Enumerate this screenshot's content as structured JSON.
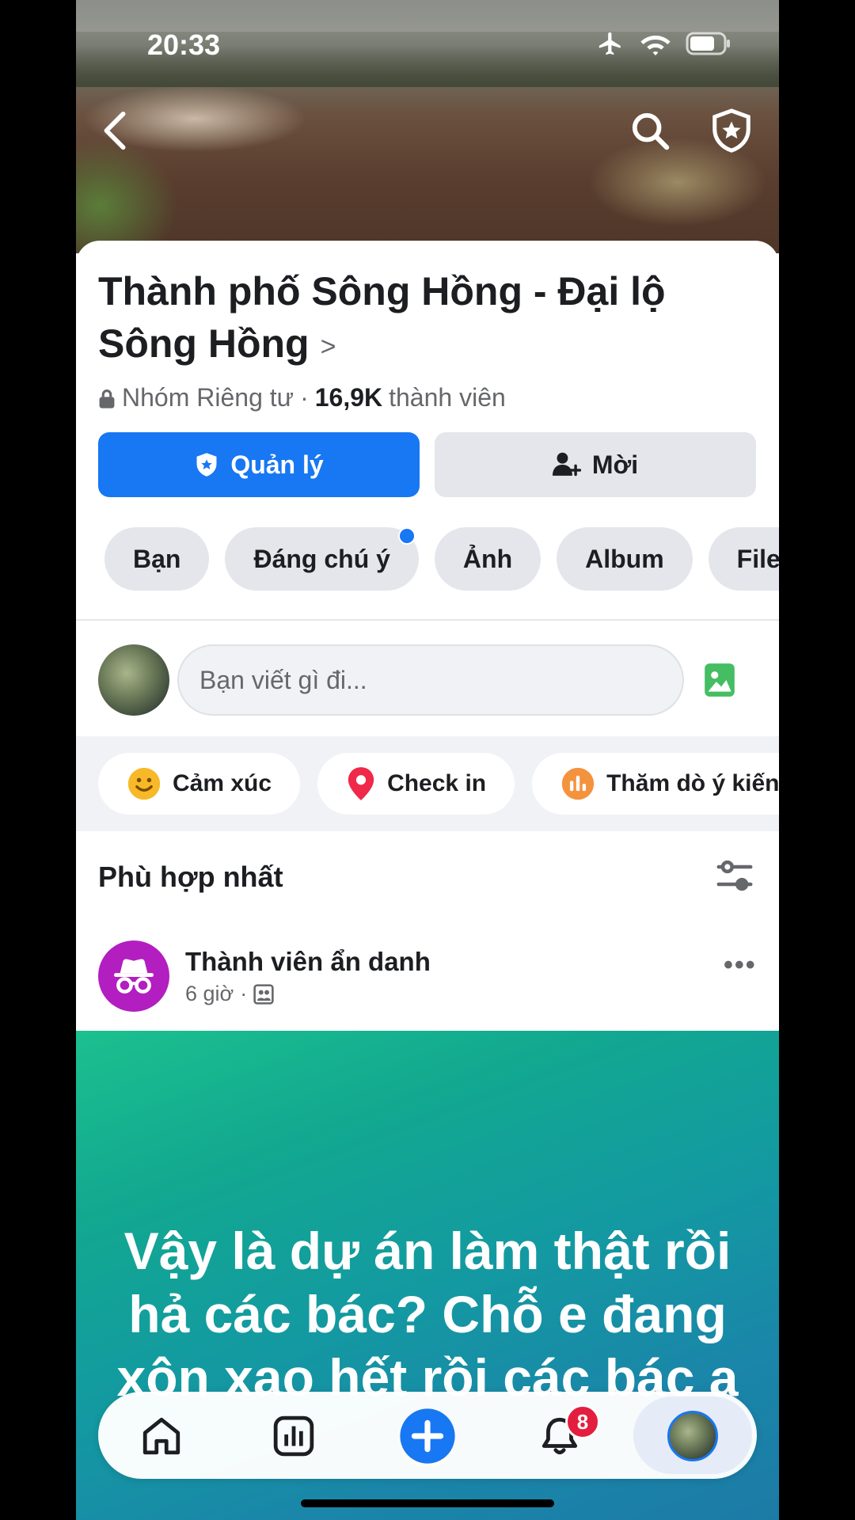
{
  "status_bar": {
    "time": "20:33"
  },
  "group": {
    "name": "Thành phố Sông Hồng - Đại lộ Sông Hồng",
    "privacy": "Nhóm Riêng tư",
    "separator": "·",
    "member_count": "16,9K",
    "member_label": "thành viên"
  },
  "buttons": {
    "manage": "Quản lý",
    "invite": "Mời"
  },
  "chips": [
    {
      "label": "Bạn",
      "dot": false
    },
    {
      "label": "Đáng chú ý",
      "dot": true
    },
    {
      "label": "Ảnh",
      "dot": false
    },
    {
      "label": "Album",
      "dot": false
    },
    {
      "label": "File",
      "dot": false
    }
  ],
  "composer": {
    "placeholder": "Bạn viết gì đi..."
  },
  "actions": [
    {
      "label": "Cảm xúc",
      "icon": "smiley-icon",
      "color": "#f7b928"
    },
    {
      "label": "Check in",
      "icon": "location-pin-icon",
      "color": "#f02849"
    },
    {
      "label": "Thăm dò ý kiến",
      "icon": "poll-icon",
      "color": "#f5923e"
    }
  ],
  "feed": {
    "sort_label": "Phù hợp nhất"
  },
  "post": {
    "author": "Thành viên ẩn danh",
    "time": "6 giờ",
    "text": "Vậy là dự án làm thật rồi hả các bác? Chỗ e đang xôn xao hết rồi các bác ạ 🥺"
  },
  "tabbar": {
    "notification_badge": "8"
  },
  "colors": {
    "primary": "#1877f2",
    "badge": "#e41e3f",
    "anon_avatar": "#b31ec0"
  }
}
